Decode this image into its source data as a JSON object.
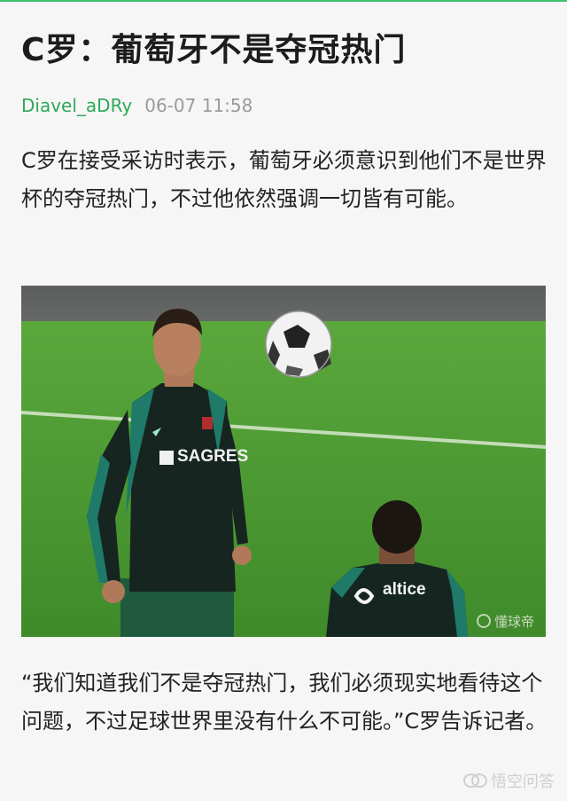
{
  "article": {
    "title": "C罗：葡萄牙不是夺冠热门",
    "author": "Diavel_aDRy",
    "time": "06-07 11:58",
    "paragraph_1": "C罗在接受采访时表示，葡萄牙必须意识到他们不是世界杯的夺冠热门，不过他依然强调一切皆有可能。",
    "paragraph_2": "“我们知道我们不是夺冠热门，我们必须现实地看待这个问题，不过足球世界里没有什么不可能。”C罗告诉记者。"
  },
  "photo": {
    "jersey_sponsor": "SAGRES",
    "back_player_sponsor": "altice",
    "photo_watermark": "懂球帝"
  },
  "watermark": {
    "label": "悟空问答"
  },
  "colors": {
    "accent": "#3cc06a",
    "author": "#2ea85a",
    "meta_gray": "#9a9a9a",
    "grass": "#4e9a34"
  }
}
